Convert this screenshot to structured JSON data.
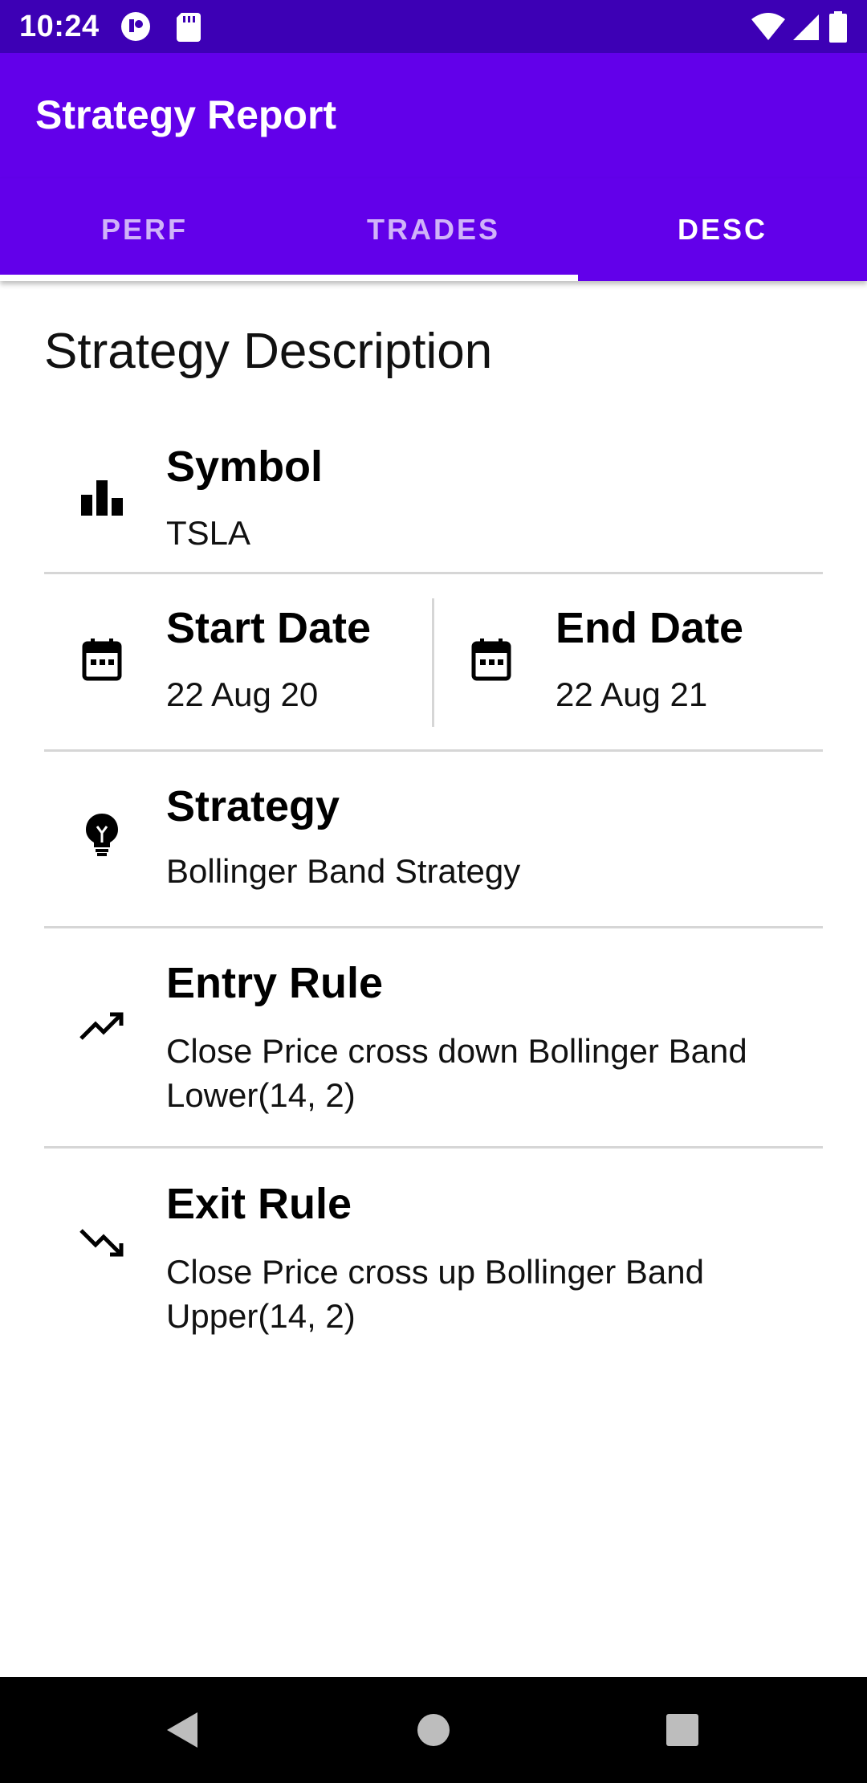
{
  "status_bar": {
    "time": "10:24",
    "icons": [
      "notification-app-icon",
      "sd-card-icon",
      "wifi-icon",
      "signal-icon",
      "battery-icon"
    ],
    "background": "#3d00b5"
  },
  "app_bar": {
    "title": "Strategy Report",
    "background": "#6200ea"
  },
  "tabs": [
    {
      "label": "PERF",
      "active": false
    },
    {
      "label": "TRADES",
      "active": false
    },
    {
      "label": "DESC",
      "active": true
    }
  ],
  "content": {
    "section_title": "Strategy Description",
    "symbol": {
      "label": "Symbol",
      "value": "TSLA",
      "icon": "bar-chart-icon"
    },
    "start_date": {
      "label": "Start Date",
      "value": "22 Aug 20",
      "icon": "calendar-icon"
    },
    "end_date": {
      "label": "End Date",
      "value": "22 Aug 21",
      "icon": "calendar-icon"
    },
    "strategy": {
      "label": "Strategy",
      "value": "Bollinger Band Strategy",
      "icon": "lightbulb-icon"
    },
    "entry_rule": {
      "label": "Entry Rule",
      "value": "Close Price cross down Bollinger Band Lower(14, 2)",
      "icon": "trending-up-icon"
    },
    "exit_rule": {
      "label": "Exit Rule",
      "value": "Close Price cross up Bollinger Band Upper(14, 2)",
      "icon": "trending-down-icon"
    }
  },
  "nav_bar": {
    "buttons": [
      "back-icon",
      "home-icon",
      "recents-icon"
    ]
  }
}
